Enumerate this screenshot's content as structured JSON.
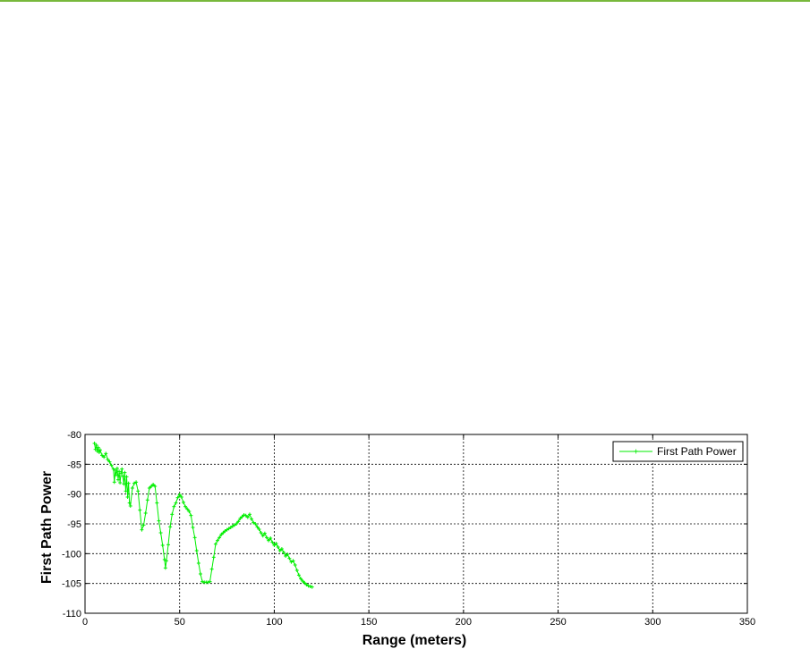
{
  "colors": {
    "top_rule": "#78b83c",
    "series": "#00ee00",
    "grid": "#000000"
  },
  "chart_data": {
    "type": "line",
    "title": "",
    "xlabel": "Range (meters)",
    "ylabel": "First Path Power",
    "xlim": [
      0,
      350
    ],
    "ylim": [
      -110,
      -80
    ],
    "xticks": [
      0,
      50,
      100,
      150,
      200,
      250,
      300,
      350
    ],
    "yticks": [
      -80,
      -85,
      -90,
      -95,
      -100,
      -105,
      -110
    ],
    "xtick_labels": [
      "0",
      "50",
      "100",
      "150",
      "200",
      "250",
      "300",
      "350"
    ],
    "ytick_labels": [
      "-80",
      "-85",
      "-90",
      "-95",
      "-100",
      "-105",
      "-110"
    ],
    "grid": true,
    "grid_style": "dashed",
    "legend_position": "top-right",
    "series": [
      {
        "name": "First Path Power",
        "color": "#00ee00",
        "marker": "plus",
        "x": [
          5,
          5.5,
          6,
          6.5,
          7,
          7.5,
          8,
          9,
          10,
          11,
          12,
          13,
          14,
          15,
          15.5,
          16,
          16.5,
          17,
          17.5,
          18,
          18.5,
          19,
          19.5,
          20,
          20.5,
          21,
          21.5,
          22,
          22.5,
          23,
          23.5,
          24,
          25,
          26,
          27,
          28,
          29,
          30,
          31,
          32,
          33,
          34,
          35,
          36,
          37,
          38,
          39,
          40,
          41,
          42,
          42.5,
          43,
          44,
          45,
          46,
          47,
          48,
          49,
          50,
          51,
          52,
          53,
          54,
          55,
          56,
          57,
          58,
          59,
          60,
          61,
          62,
          63,
          64,
          65,
          66,
          67,
          68,
          69,
          70,
          71,
          72,
          73,
          74,
          75,
          76,
          77,
          78,
          79,
          80,
          81,
          82,
          83,
          84,
          85,
          86,
          87,
          88,
          89,
          90,
          91,
          92,
          93,
          94,
          95,
          96,
          97,
          98,
          99,
          100,
          101,
          102,
          103,
          104,
          105,
          106,
          107,
          108,
          109,
          110,
          111,
          112,
          113,
          114,
          115,
          116,
          117,
          118,
          119,
          120
        ],
        "y": [
          -81.5,
          -82.5,
          -81.8,
          -82.8,
          -82.2,
          -83,
          -82.6,
          -83.5,
          -83.8,
          -83.2,
          -84.2,
          -84.6,
          -85.2,
          -85.8,
          -88,
          -86,
          -86.8,
          -85.7,
          -87.6,
          -86.2,
          -88.1,
          -86.5,
          -85.8,
          -87,
          -88.3,
          -86.4,
          -89.5,
          -87.1,
          -90.5,
          -88.2,
          -91.5,
          -92,
          -89,
          -88.2,
          -88,
          -89.5,
          -92.7,
          -96,
          -95.2,
          -93.2,
          -91,
          -89,
          -88.7,
          -88.4,
          -88.7,
          -91.5,
          -94.5,
          -96.5,
          -98.6,
          -101,
          -102.4,
          -101.2,
          -98.5,
          -95.5,
          -93.4,
          -92.1,
          -91.5,
          -90.6,
          -90.1,
          -90.5,
          -91.4,
          -92.1,
          -92.5,
          -92.9,
          -93.6,
          -95.6,
          -97.3,
          -99.5,
          -101.6,
          -103.4,
          -104.7,
          -104.8,
          -104.8,
          -104.8,
          -104.7,
          -102.6,
          -100.6,
          -98.4,
          -97.8,
          -97.3,
          -96.8,
          -96.5,
          -96.2,
          -96.0,
          -95.8,
          -95.6,
          -95.4,
          -95.2,
          -95.0,
          -94.6,
          -94.1,
          -93.8,
          -93.5,
          -93.6,
          -93.9,
          -93.4,
          -94.2,
          -94.8,
          -95.0,
          -95.5,
          -95.9,
          -96.5,
          -97.0,
          -96.6,
          -97.3,
          -97.8,
          -97.4,
          -98.1,
          -98.6,
          -98.3,
          -98.9,
          -99.5,
          -99.2,
          -99.8,
          -100.4,
          -100.1,
          -100.8,
          -101.4,
          -101.2,
          -101.9,
          -102.8,
          -103.6,
          -104.2,
          -104.6,
          -104.9,
          -105.2,
          -105.4,
          -105.5,
          -105.6
        ]
      }
    ]
  }
}
